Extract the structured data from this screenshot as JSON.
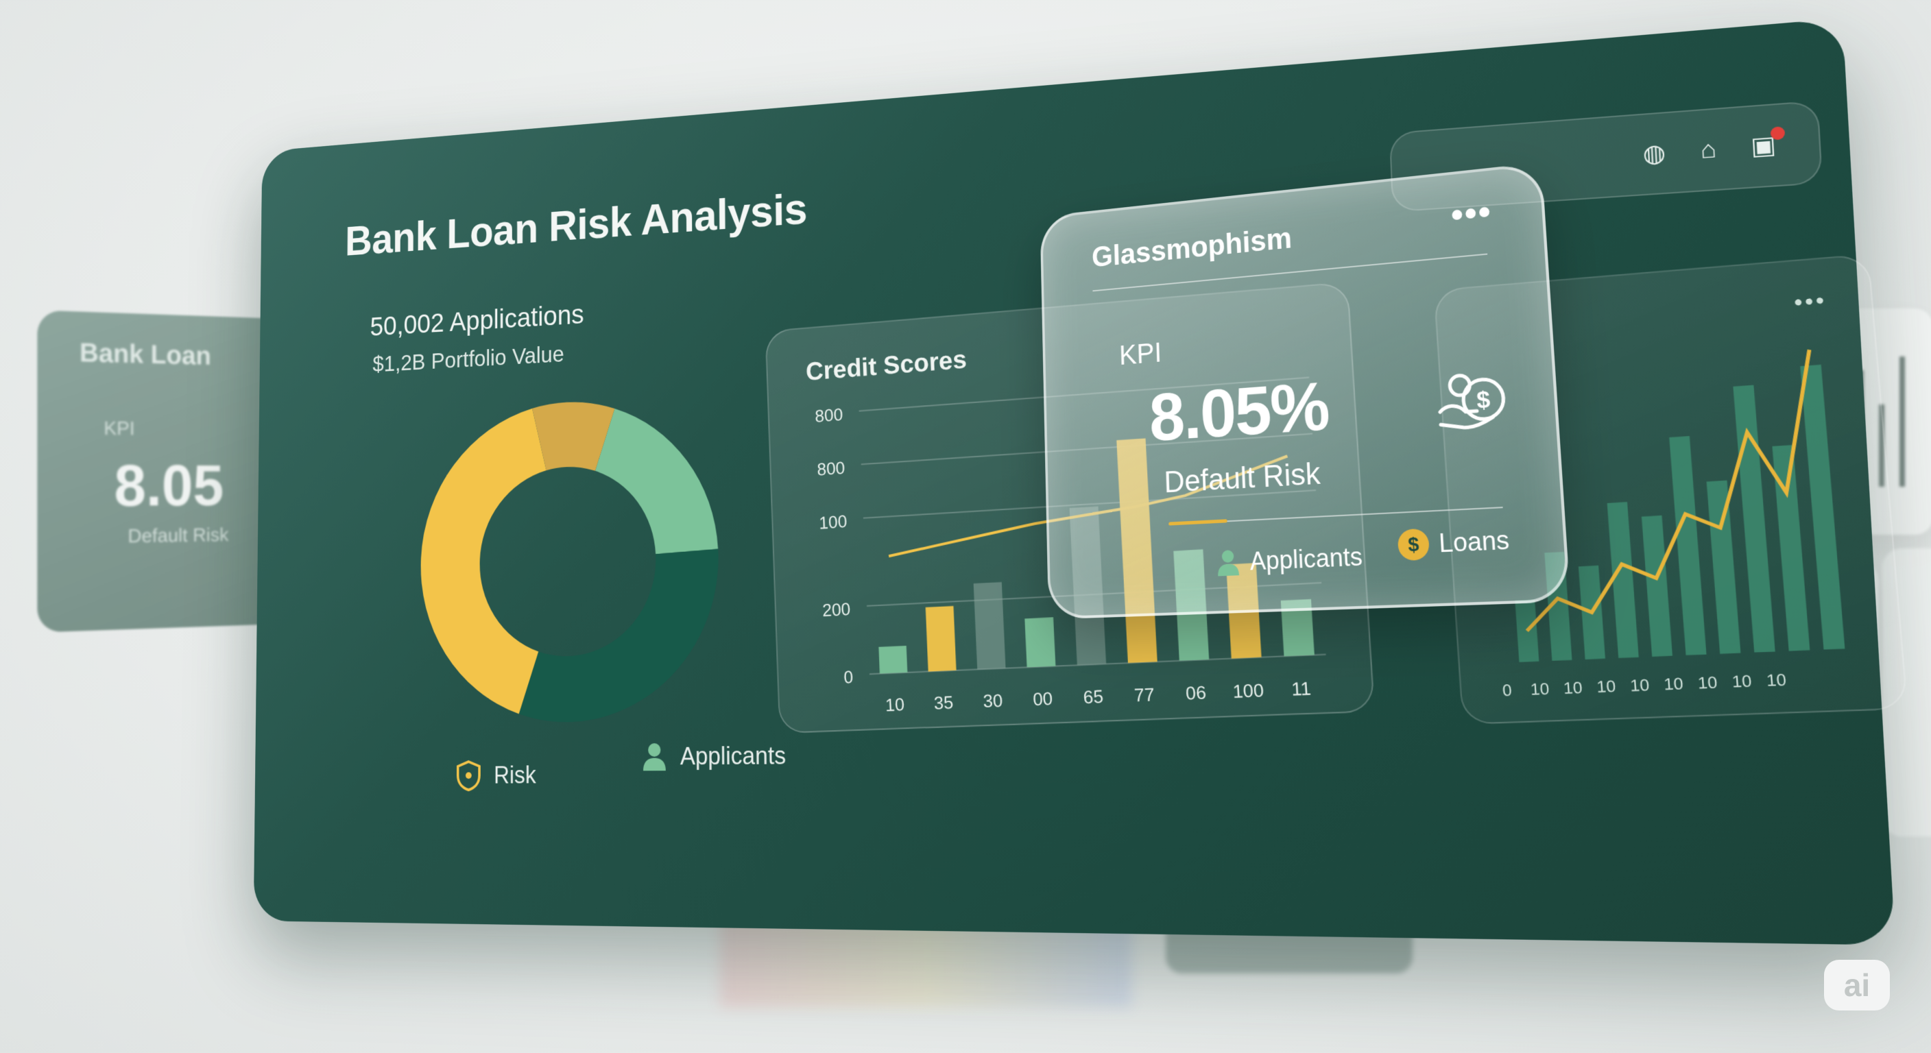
{
  "ghost_left": {
    "title": "Bank Loan",
    "kpi": "KPI",
    "value": "8.05",
    "label": "Default Risk"
  },
  "main": {
    "title": "Bank Loan Risk Analysis",
    "applications": "50,002 Applications",
    "portfolio": "$1,2B Portfolio Value",
    "legend": {
      "risk": "Risk",
      "applicants": "Applicants"
    }
  },
  "donut": {
    "segments": [
      {
        "name": "green-light",
        "fraction": 0.19,
        "color": "#7cc39a"
      },
      {
        "name": "green-dark",
        "fraction": 0.31,
        "color": "#175a4a"
      },
      {
        "name": "yellow",
        "fraction": 0.41,
        "color": "#f3c44a"
      },
      {
        "name": "gold",
        "fraction": 0.09,
        "color": "#d4a94a"
      }
    ]
  },
  "credit_chart": {
    "title": "Credit Scores",
    "y_ticks": [
      "800",
      "800",
      "100",
      "200",
      "0"
    ],
    "x_ticks": [
      "10",
      "35",
      "30",
      "00",
      "65",
      "77",
      "06",
      "100",
      "11"
    ],
    "bars": [
      {
        "value": 0.1,
        "color": "#7cc39a"
      },
      {
        "value": 0.24,
        "color": "#f3c44a"
      },
      {
        "value": 0.32,
        "color": "#8aa69c"
      },
      {
        "value": 0.18,
        "color": "#7cc39a"
      },
      {
        "value": 0.58,
        "color": "#8aa69c"
      },
      {
        "value": 0.82,
        "color": "#f3c44a"
      },
      {
        "value": 0.4,
        "color": "#7cc39a"
      },
      {
        "value": 0.34,
        "color": "#f3c44a"
      },
      {
        "value": 0.2,
        "color": "#7cc39a"
      }
    ],
    "line": [
      0.44,
      0.47,
      0.5,
      0.53,
      0.55,
      0.57,
      0.6,
      0.66,
      0.72
    ]
  },
  "right_chart": {
    "x_ticks": [
      "0",
      "10",
      "10",
      "10",
      "10",
      "10",
      "10",
      "10",
      "10"
    ],
    "bars": [
      0.2,
      0.35,
      0.3,
      0.5,
      0.45,
      0.7,
      0.55,
      0.85,
      0.65,
      0.9
    ],
    "line": [
      0.1,
      0.2,
      0.15,
      0.3,
      0.25,
      0.45,
      0.4,
      0.7,
      0.5,
      0.95
    ]
  },
  "glass_card": {
    "title": "Glassmophism",
    "menu": "•••",
    "kpi": "KPI",
    "value": "8.05%",
    "label": "Default Risk",
    "legend": {
      "applicants": "Applicants",
      "loans": "Loans"
    }
  },
  "toolbar": {
    "icons": [
      "globe-icon",
      "bell-icon",
      "lock-icon"
    ]
  },
  "badge": {
    "text": "ai"
  }
}
